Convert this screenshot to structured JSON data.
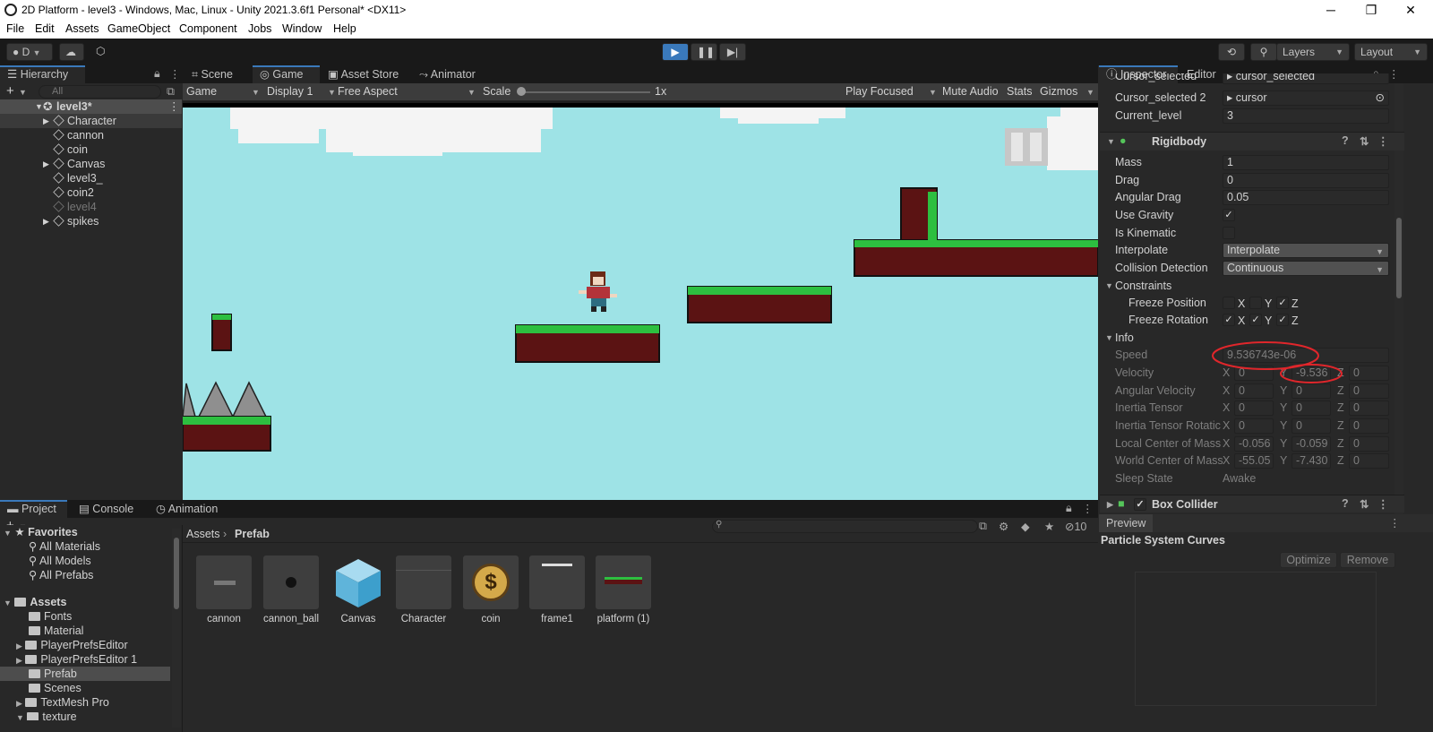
{
  "window": {
    "title": "2D Platform - level3 - Windows, Mac, Linux - Unity 2021.3.6f1 Personal* <DX11>",
    "min": "─",
    "max": "❐",
    "close": "✕"
  },
  "menu": [
    "File",
    "Edit",
    "Assets",
    "GameObject",
    "Component",
    "Jobs",
    "Window",
    "Help"
  ],
  "toolbar": {
    "account": "D",
    "layers": "Layers",
    "layout": "Layout"
  },
  "hierarchy": {
    "tab": "Hierarchy",
    "search_placeholder": "All",
    "scene": "level3*",
    "items": [
      "Character",
      "cannon",
      "coin",
      "Canvas",
      "level3_",
      "coin2",
      "level4",
      "spikes"
    ]
  },
  "game_view": {
    "tabs": [
      "Scene",
      "Game",
      "Asset Store",
      "Animator"
    ],
    "mode": "Game",
    "display": "Display 1",
    "aspect": "Free Aspect",
    "scale_label": "Scale",
    "scale_value": "1x",
    "play_focused": "Play Focused",
    "mute": "Mute Audio",
    "stats": "Stats",
    "gizmos": "Gizmos"
  },
  "inspector": {
    "tabs": [
      "Inspector",
      "Editor"
    ],
    "top_fields": [
      {
        "label": "Cursor_selected",
        "value": "cursor_selected"
      },
      {
        "label": "Cursor_selected 2",
        "value": "cursor"
      },
      {
        "label": "Current_level",
        "value": "3"
      }
    ],
    "rigidbody": {
      "title": "Rigidbody",
      "mass_label": "Mass",
      "mass": "1",
      "drag_label": "Drag",
      "drag": "0",
      "angular_drag_label": "Angular Drag",
      "angular_drag": "0.05",
      "use_gravity_label": "Use Gravity",
      "is_kinematic_label": "Is Kinematic",
      "interpolate_label": "Interpolate",
      "interpolate": "Interpolate",
      "collision_label": "Collision Detection",
      "collision": "Continuous",
      "constraints_label": "Constraints",
      "freeze_pos_label": "Freeze Position",
      "freeze_rot_label": "Freeze Rotation"
    },
    "info": {
      "title": "Info",
      "speed_label": "Speed",
      "speed": "9.536743e-06",
      "velocity_label": "Velocity",
      "velocity": [
        "0",
        "-9.536",
        "0"
      ],
      "ang_vel_label": "Angular Velocity",
      "ang_vel": [
        "0",
        "0",
        "0"
      ],
      "inertia_label": "Inertia Tensor",
      "inertia": [
        "0",
        "0",
        "0"
      ],
      "inertia_rot_label": "Inertia Tensor Rotatic",
      "inertia_rot": [
        "0",
        "0",
        "0"
      ],
      "local_com_label": "Local Center of Mass",
      "local_com": [
        "-0.056",
        "-0.059",
        "0"
      ],
      "world_com_label": "World Center of Mass",
      "world_com": [
        "-55.05",
        "-7.430",
        "0"
      ],
      "sleep_label": "Sleep State",
      "sleep": "Awake"
    },
    "box_collider": "Box Collider",
    "preview": {
      "tab": "Preview",
      "title": "Particle System Curves",
      "optimize": "Optimize",
      "remove": "Remove"
    }
  },
  "project": {
    "tabs": [
      "Project",
      "Console",
      "Animation"
    ],
    "favorites": "Favorites",
    "fav_items": [
      "All Materials",
      "All Models",
      "All Prefabs"
    ],
    "assets": "Assets",
    "folders": [
      "Fonts",
      "Material",
      "PlayerPrefsEditor",
      "PlayerPrefsEditor 1",
      "Prefab",
      "Scenes",
      "TextMesh Pro",
      "texture"
    ],
    "breadcrumb_root": "Assets",
    "breadcrumb_leaf": "Prefab",
    "hidden_count": "10",
    "asset_items": [
      "cannon",
      "cannon_ball",
      "Canvas",
      "Character",
      "coin",
      "frame1",
      "platform (1)"
    ]
  },
  "colors": {
    "sky": "#9ee3e6",
    "grass": "#2dbf40",
    "soil": "#5b1313",
    "accent": "#3a79bb",
    "annotation": "#e0262b"
  }
}
